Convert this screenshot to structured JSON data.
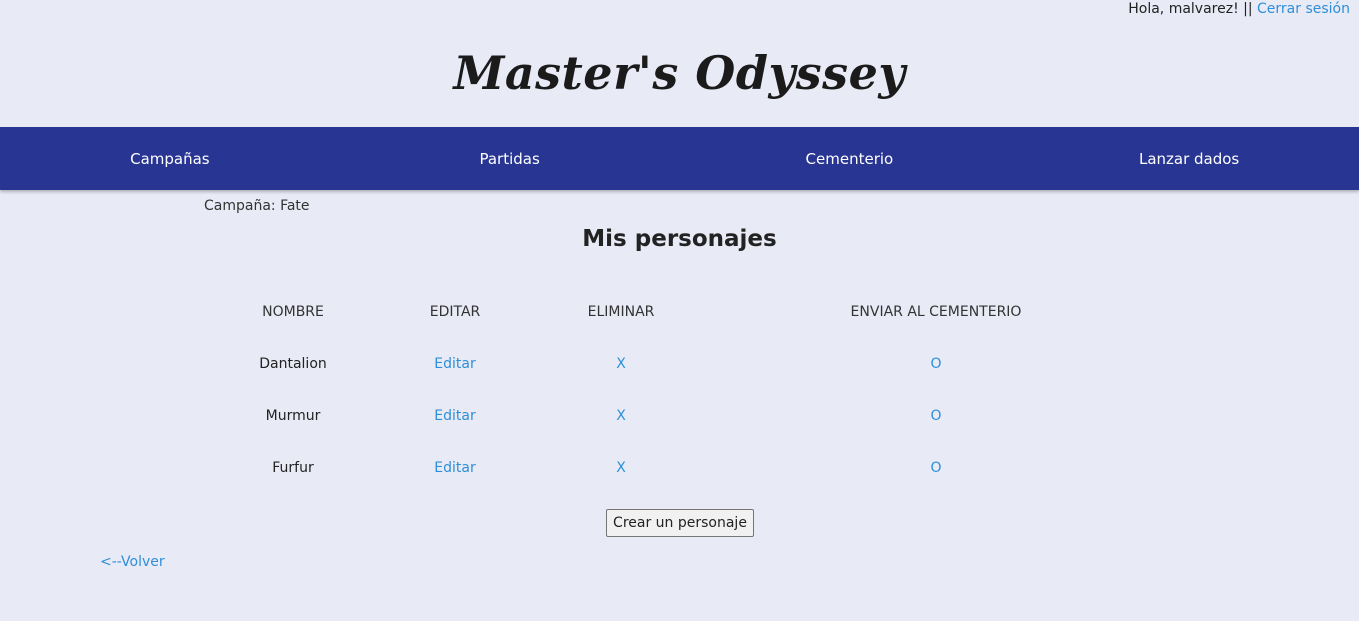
{
  "header": {
    "greeting": "Hola, malvarez! ||",
    "logout_label": "Cerrar sesión",
    "brand_title": "Master's Odyssey"
  },
  "nav": {
    "items": [
      {
        "label": "Campañas"
      },
      {
        "label": "Partidas"
      },
      {
        "label": "Cementerio"
      },
      {
        "label": "Lanzar dados"
      }
    ]
  },
  "main": {
    "campaign_label": "Campaña: Fate",
    "heading": "Mis personajes",
    "table": {
      "columns": [
        "NOMBRE",
        "EDITAR",
        "ELIMINAR",
        "ENVIAR AL CEMENTERIO"
      ],
      "rows": [
        {
          "name": "Dantalion",
          "edit": "Editar",
          "delete": "X",
          "graveyard": "O"
        },
        {
          "name": "Murmur",
          "edit": "Editar",
          "delete": "X",
          "graveyard": "O"
        },
        {
          "name": "Furfur",
          "edit": "Editar",
          "delete": "X",
          "graveyard": "O"
        }
      ]
    },
    "create_button_label": "Crear un personaje",
    "back_link_label": "<--Volver"
  },
  "colors": {
    "background": "#e8eaf6",
    "nav_background": "#283593",
    "link": "#2f8fd8"
  }
}
